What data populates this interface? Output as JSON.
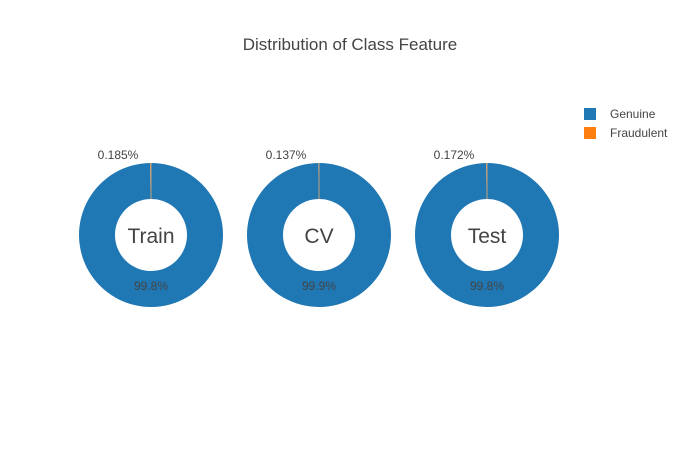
{
  "chart_data": {
    "type": "pie",
    "title": "Distribution of Class Feature",
    "legend": {
      "position": "top-right",
      "items": [
        {
          "name": "Genuine",
          "color": "#1f77b4"
        },
        {
          "name": "Fraudulent",
          "color": "#ff7f0e"
        }
      ]
    },
    "charts": [
      {
        "label": "Train",
        "slices": [
          {
            "name": "Genuine",
            "value": 99.815,
            "label": "99.8%"
          },
          {
            "name": "Fraudulent",
            "value": 0.185,
            "label": "0.185%"
          }
        ]
      },
      {
        "label": "CV",
        "slices": [
          {
            "name": "Genuine",
            "value": 99.863,
            "label": "99.9%"
          },
          {
            "name": "Fraudulent",
            "value": 0.137,
            "label": "0.137%"
          }
        ]
      },
      {
        "label": "Test",
        "slices": [
          {
            "name": "Genuine",
            "value": 99.828,
            "label": "99.8%"
          },
          {
            "name": "Fraudulent",
            "value": 0.172,
            "label": "0.172%"
          }
        ]
      }
    ]
  }
}
